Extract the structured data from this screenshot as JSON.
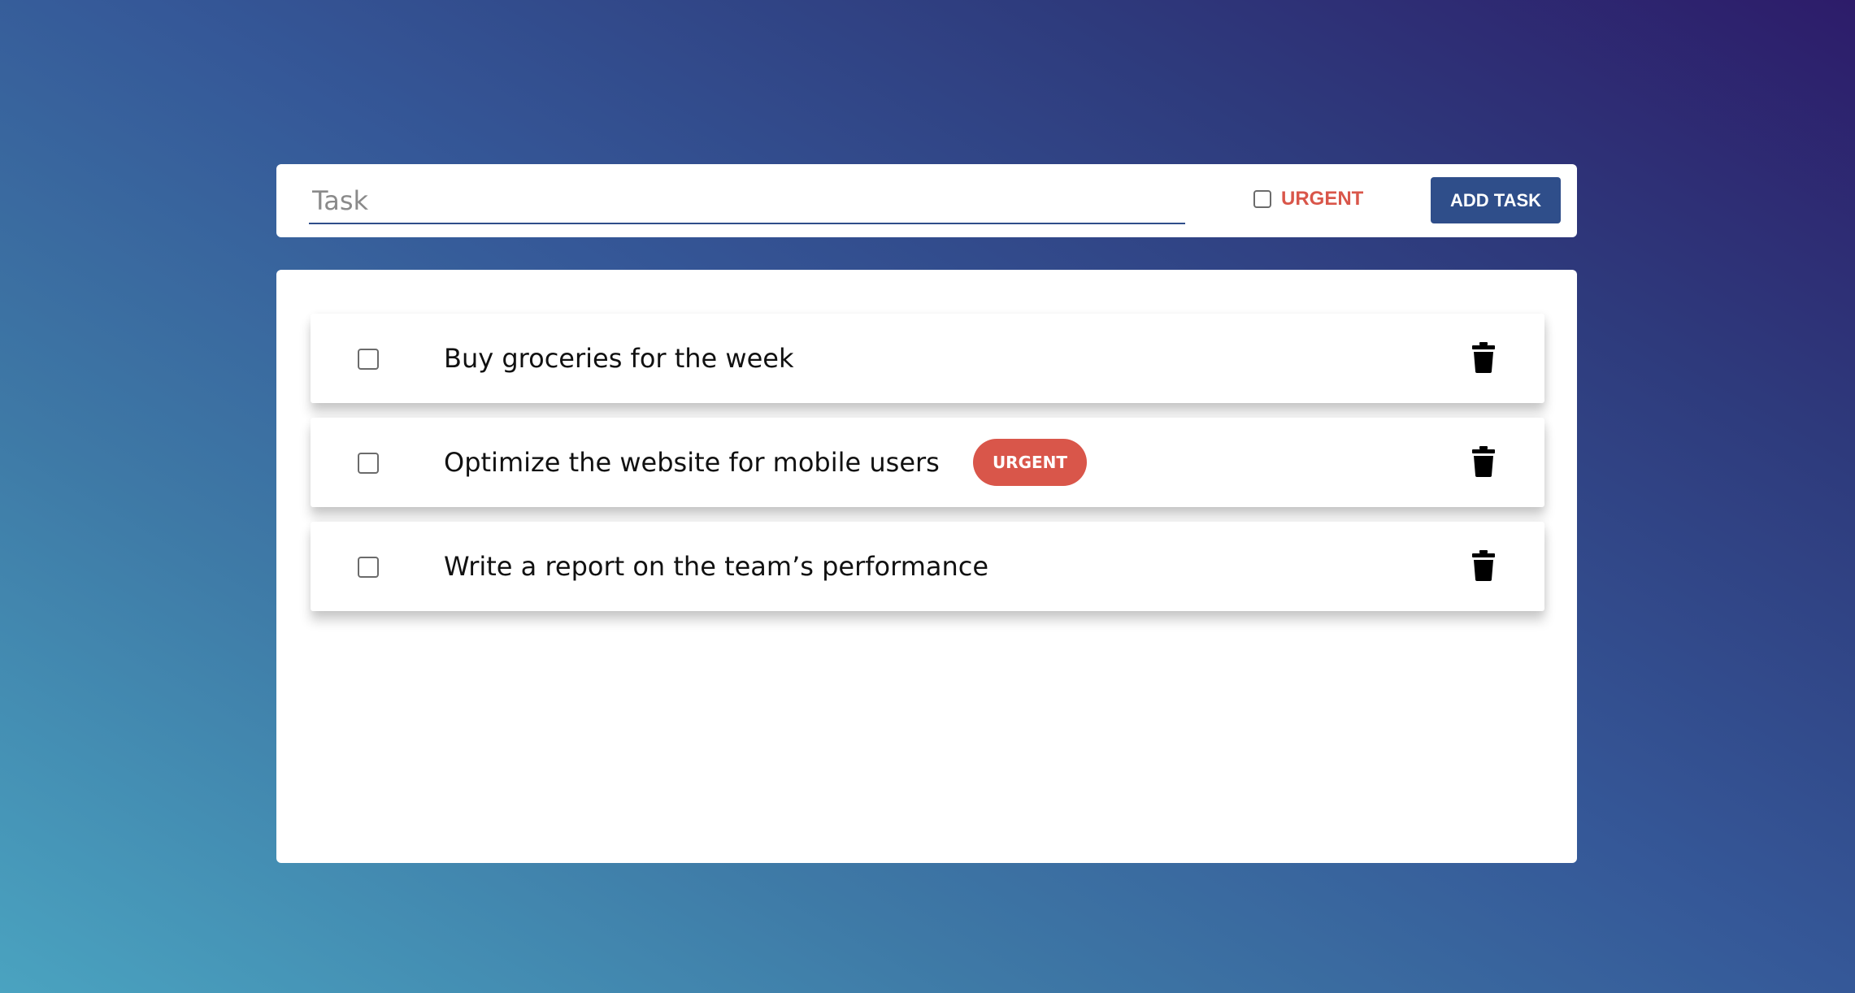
{
  "form": {
    "task_placeholder": "Task",
    "task_value": "",
    "urgent_label": "URGENT",
    "urgent_checked": false,
    "add_button_label": "ADD TASK"
  },
  "tasks": [
    {
      "text": "Buy groceries for the week",
      "urgent": false,
      "done": false,
      "delete_icon": "trash-icon"
    },
    {
      "text": "Optimize the website for mobile users",
      "urgent": true,
      "badge_label": "URGENT",
      "done": false,
      "delete_icon": "trash-icon"
    },
    {
      "text": "Write a report on the team’s performance",
      "urgent": false,
      "done": false,
      "delete_icon": "trash-icon"
    }
  ],
  "colors": {
    "accent": "#2f4e8a",
    "urgent": "#d9564a",
    "gradient_start": "#4aa3c0",
    "gradient_end": "#2d1c6a"
  }
}
